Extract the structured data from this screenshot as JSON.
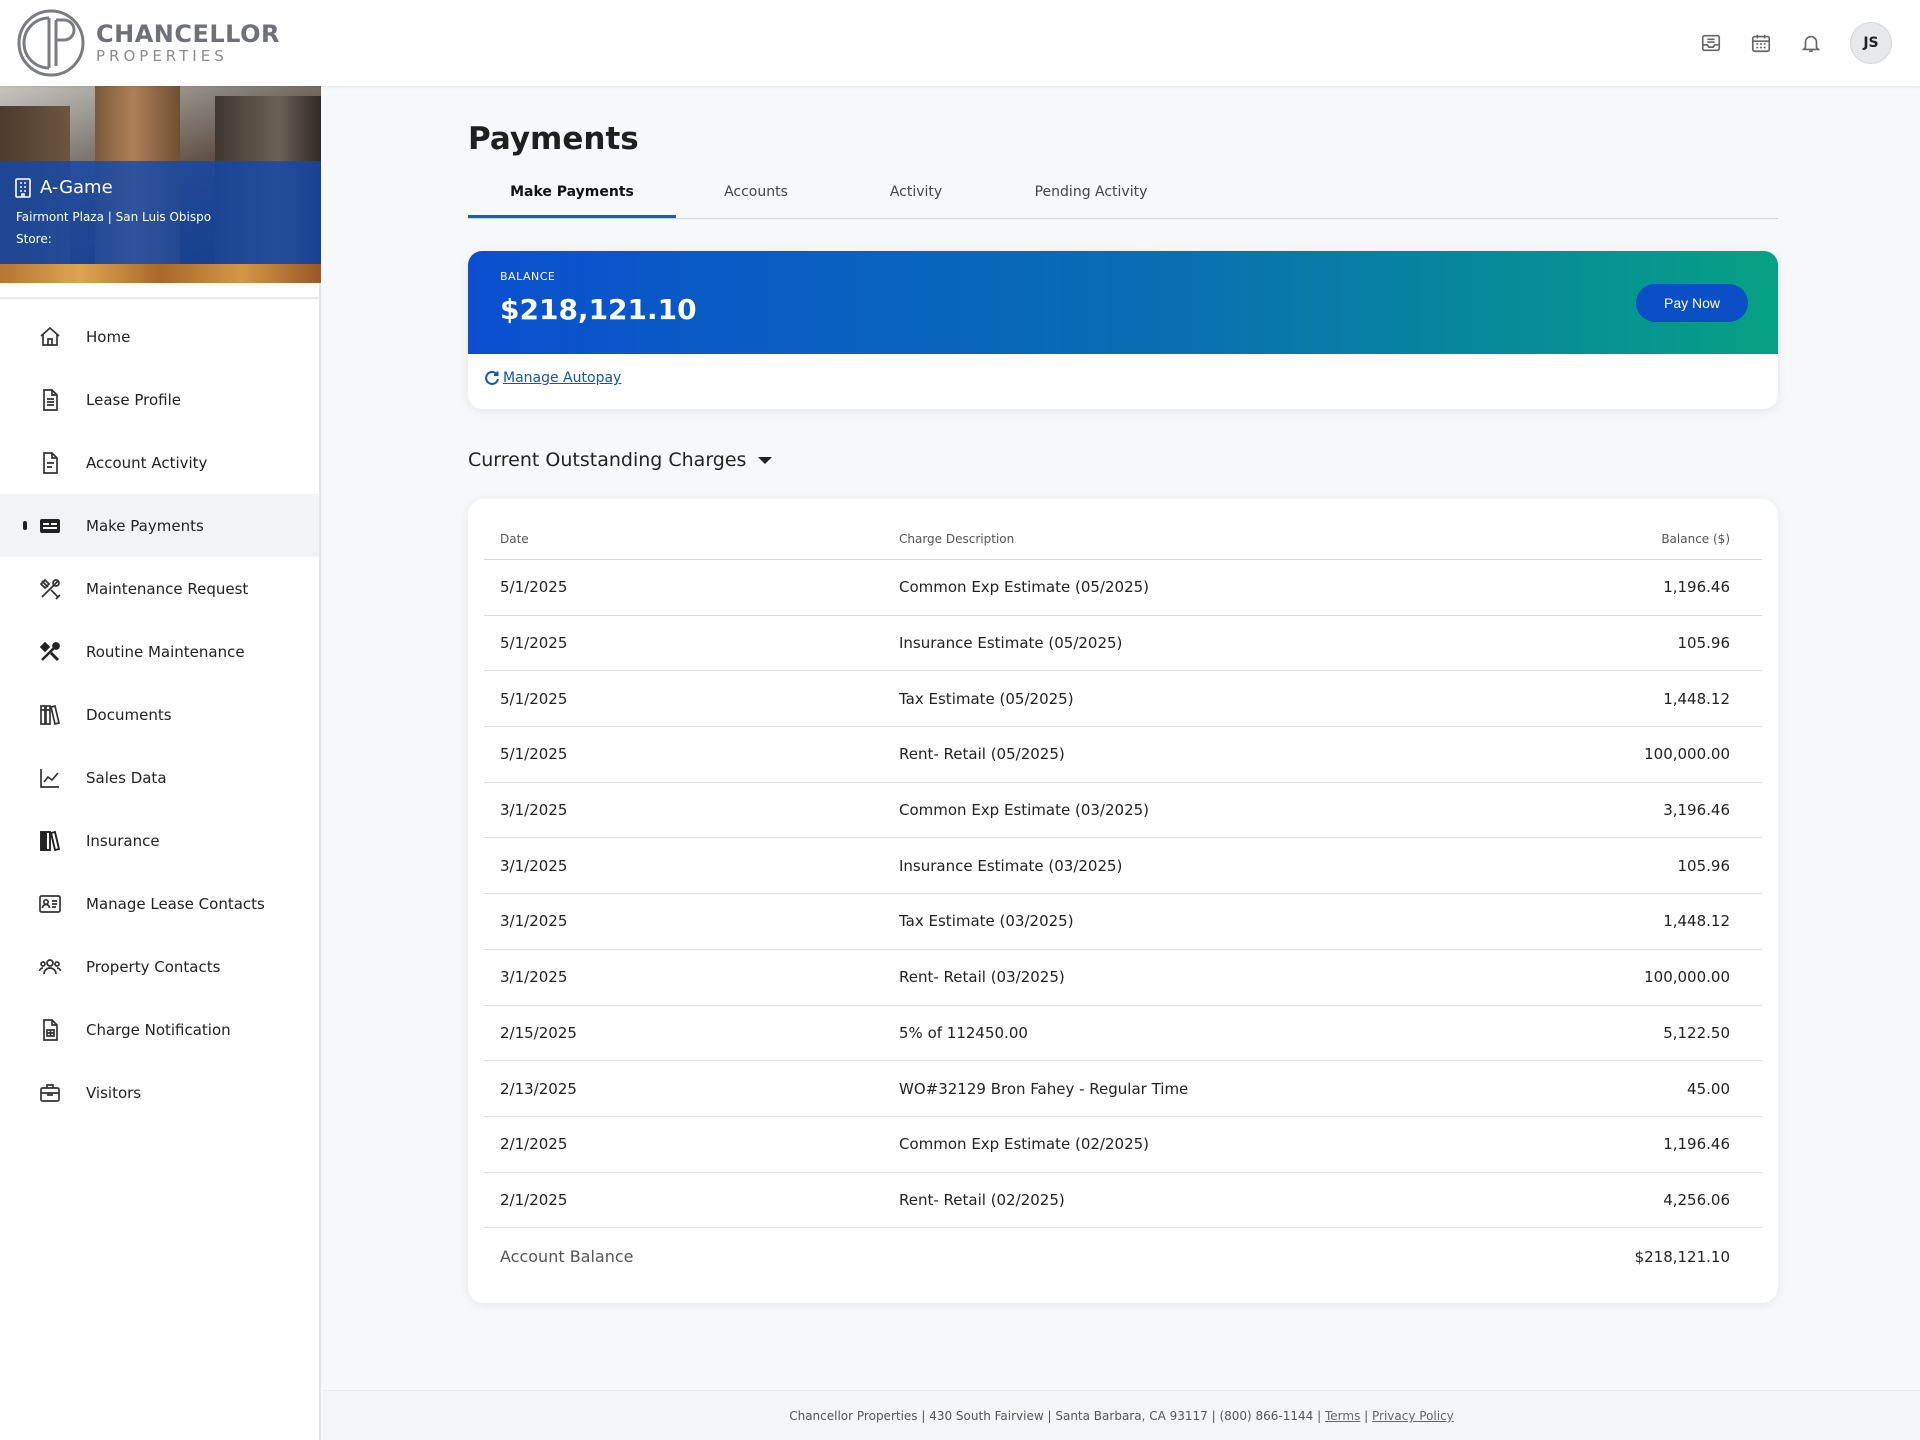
{
  "brand": {
    "line1": "CHANCELLOR",
    "line2": "PROPERTIES"
  },
  "header": {
    "icons": [
      "inbox-icon",
      "calendar-icon",
      "bell-icon"
    ],
    "avatar_initials": "JS"
  },
  "store": {
    "name": "A-Game",
    "location": "Fairmont Plaza | San Luis Obispo",
    "label": "Store:"
  },
  "sidebar": {
    "items": [
      {
        "label": "Home",
        "icon": "home-icon"
      },
      {
        "label": "Lease Profile",
        "icon": "document-icon"
      },
      {
        "label": "Account Activity",
        "icon": "file-icon"
      },
      {
        "label": "Make Payments",
        "icon": "payment-card-icon",
        "active": true
      },
      {
        "label": "Maintenance Request",
        "icon": "tools-icon"
      },
      {
        "label": "Routine Maintenance",
        "icon": "tools-filled-icon"
      },
      {
        "label": "Documents",
        "icon": "books-icon"
      },
      {
        "label": "Sales Data",
        "icon": "line-chart-icon"
      },
      {
        "label": "Insurance",
        "icon": "books-filled-icon"
      },
      {
        "label": "Manage Lease Contacts",
        "icon": "contact-card-icon"
      },
      {
        "label": "Property Contacts",
        "icon": "people-icon"
      },
      {
        "label": "Charge Notification",
        "icon": "receipt-icon"
      },
      {
        "label": "Visitors",
        "icon": "briefcase-icon"
      }
    ]
  },
  "main": {
    "title": "Payments",
    "tabs": [
      {
        "label": "Make Payments",
        "active": true
      },
      {
        "label": "Accounts"
      },
      {
        "label": "Activity"
      },
      {
        "label": "Pending Activity"
      }
    ],
    "balance": {
      "label": "BALANCE",
      "amount": "$218,121.10",
      "pay_button": "Pay Now",
      "autopay_link": "Manage Autopay"
    },
    "charges": {
      "section_title": "Current Outstanding Charges",
      "columns": {
        "date": "Date",
        "description": "Charge Description",
        "balance": "Balance ($)"
      },
      "rows": [
        {
          "date": "5/1/2025",
          "description": "Common Exp Estimate (05/2025)",
          "balance": "1,196.46"
        },
        {
          "date": "5/1/2025",
          "description": "Insurance Estimate (05/2025)",
          "balance": "105.96"
        },
        {
          "date": "5/1/2025",
          "description": "Tax Estimate (05/2025)",
          "balance": "1,448.12"
        },
        {
          "date": "5/1/2025",
          "description": "Rent- Retail (05/2025)",
          "balance": "100,000.00"
        },
        {
          "date": "3/1/2025",
          "description": "Common Exp Estimate (03/2025)",
          "balance": "3,196.46"
        },
        {
          "date": "3/1/2025",
          "description": "Insurance Estimate (03/2025)",
          "balance": "105.96"
        },
        {
          "date": "3/1/2025",
          "description": "Tax Estimate (03/2025)",
          "balance": "1,448.12"
        },
        {
          "date": "3/1/2025",
          "description": "Rent- Retail (03/2025)",
          "balance": "100,000.00"
        },
        {
          "date": "2/15/2025",
          "description": "5% of 112450.00",
          "balance": "5,122.50"
        },
        {
          "date": "2/13/2025",
          "description": "WO#32129 Bron Fahey - Regular Time",
          "balance": "45.00"
        },
        {
          "date": "2/1/2025",
          "description": "Common Exp Estimate (02/2025)",
          "balance": "1,196.46"
        },
        {
          "date": "2/1/2025",
          "description": "Rent- Retail (02/2025)",
          "balance": "4,256.06"
        }
      ],
      "total_label": "Account Balance",
      "total_value": "$218,121.10"
    }
  },
  "footer": {
    "text": "Chancellor Properties | 430 South Fairview | Santa Barbara, CA 93117 | (800) 866-1144 | ",
    "terms": "Terms",
    "separator": " | ",
    "privacy": "Privacy Policy"
  },
  "colors": {
    "accent": "#1a5cb8",
    "balance_gradient_start": "#0b4fd0",
    "balance_gradient_end": "#06a184",
    "pay_button": "#0b4fc6"
  }
}
